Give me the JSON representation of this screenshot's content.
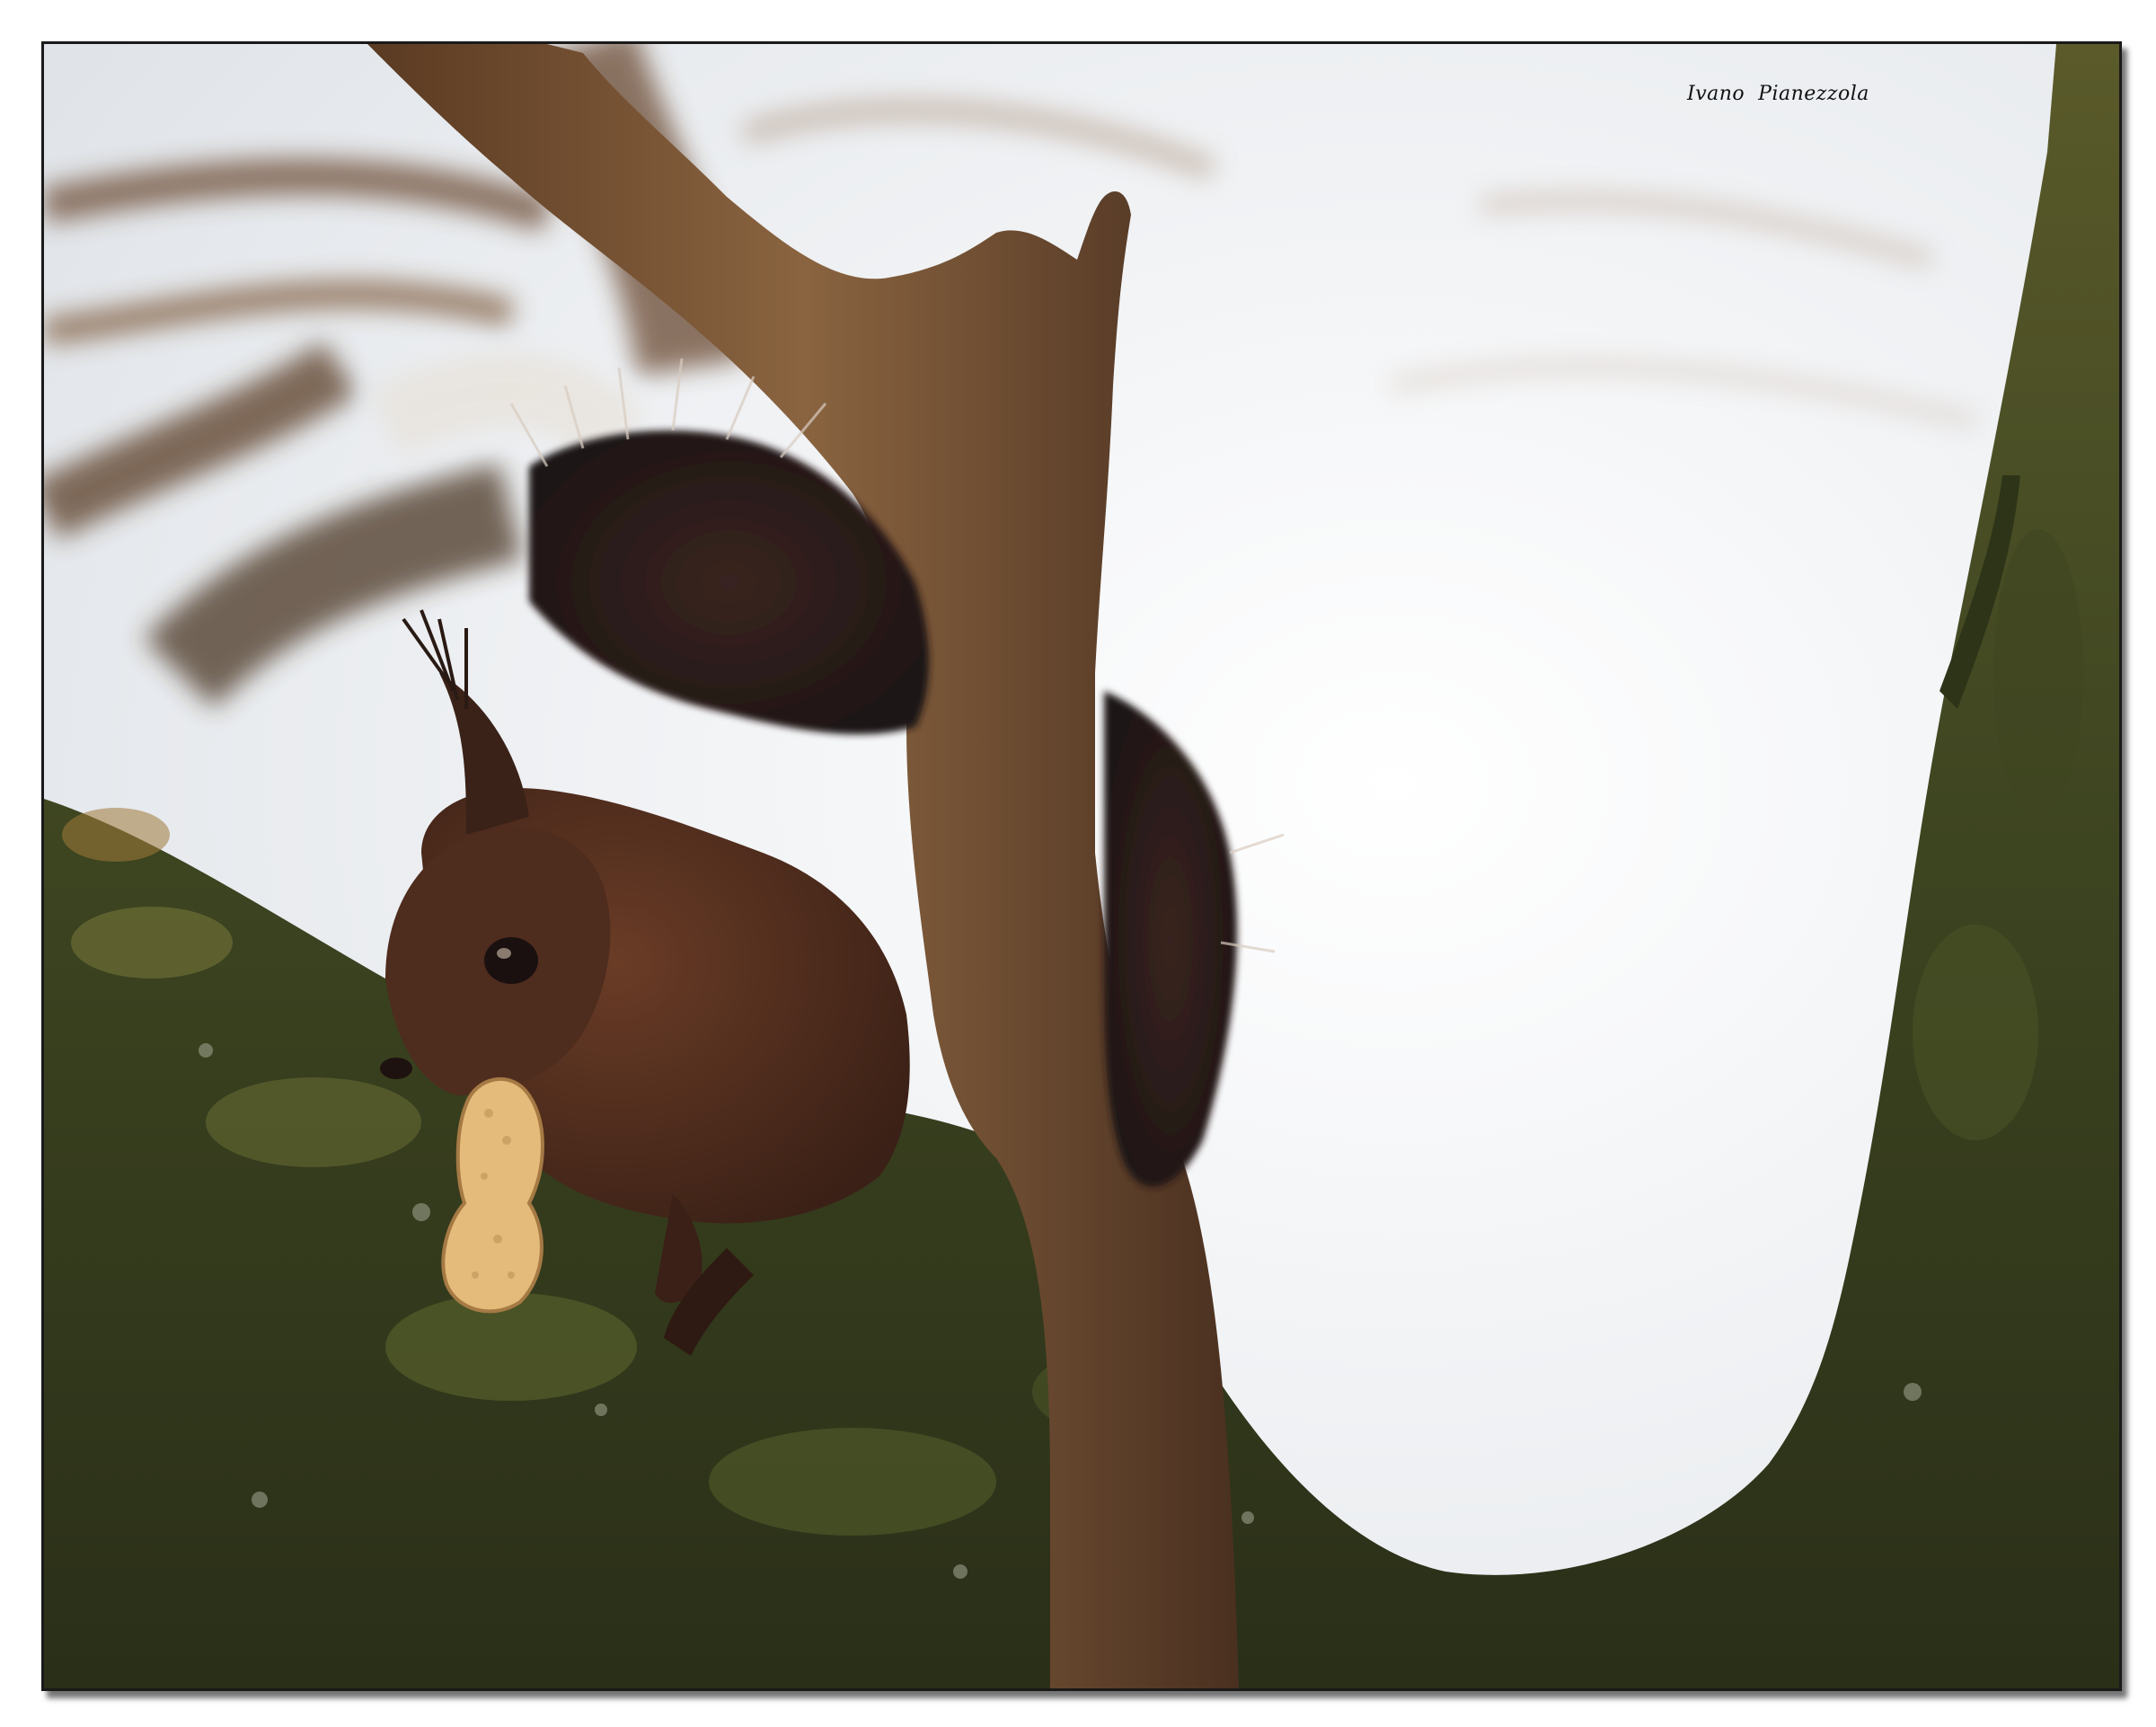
{
  "photo": {
    "subject": "red-squirrel",
    "signature": "Ivano  Pianezzola"
  },
  "colors": {
    "sky": "#eef0f3",
    "bark": "#3f4a22",
    "branch": "#6b4a2e",
    "squirrel_fur": "#4a2a1c",
    "tail": "#2a1f1d",
    "peanut": "#e2b978"
  }
}
